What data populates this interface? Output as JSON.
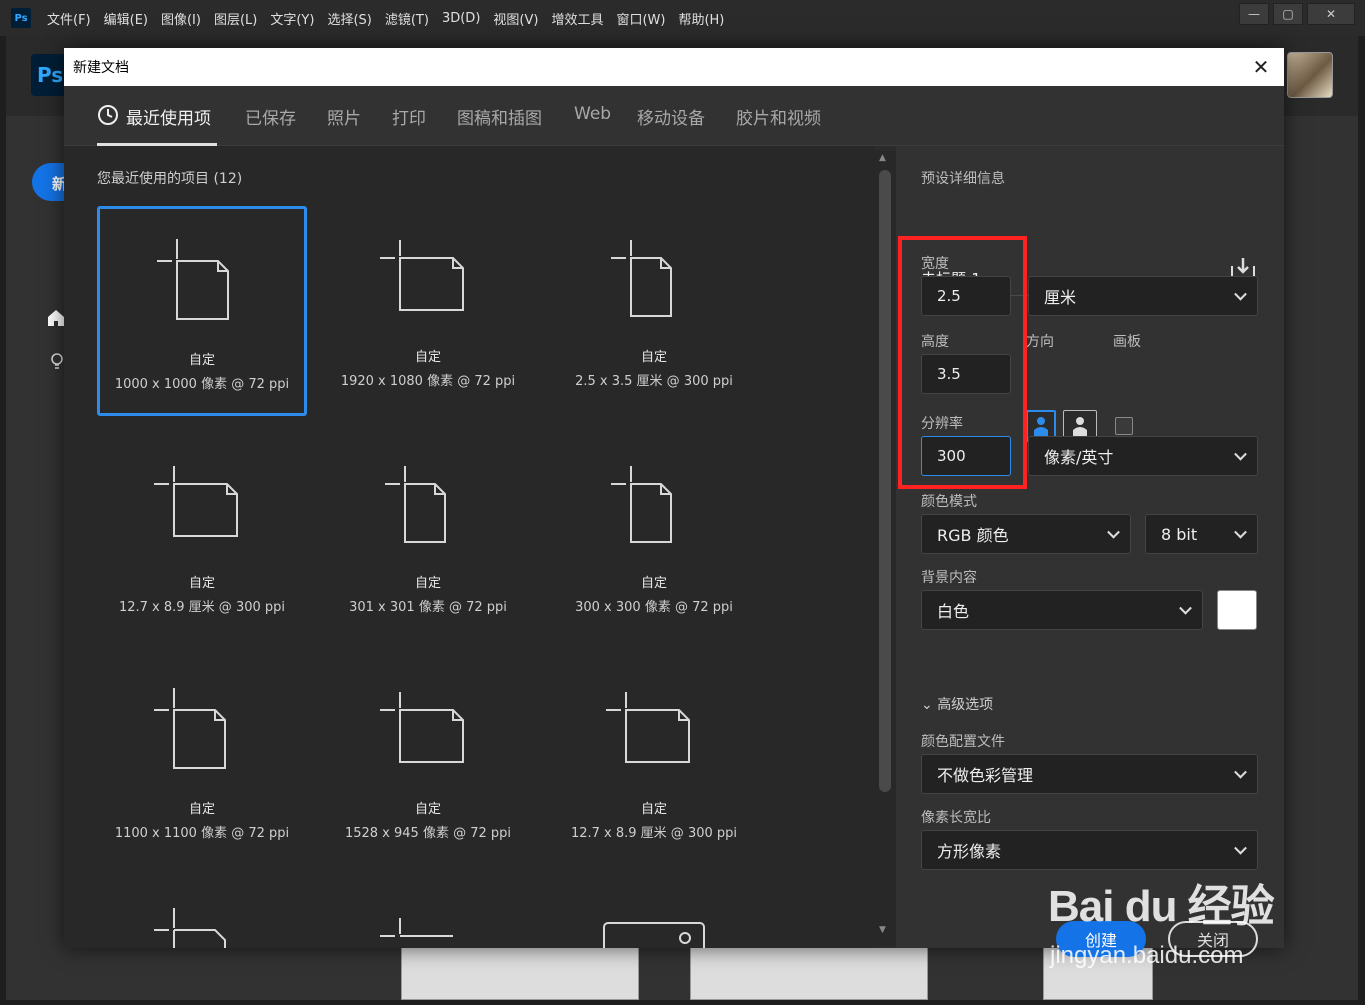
{
  "menubar": {
    "logo": "Ps",
    "items": [
      "文件(F)",
      "编辑(E)",
      "图像(I)",
      "图层(L)",
      "文字(Y)",
      "选择(S)",
      "滤镜(T)",
      "3D(D)",
      "视图(V)",
      "增效工具",
      "窗口(W)",
      "帮助(H)"
    ],
    "window_controls": [
      "—",
      "▢",
      "✕"
    ]
  },
  "home": {
    "logo": "Ps",
    "new_button": "新"
  },
  "dialog": {
    "title": "新建文档",
    "close": "✕",
    "tabs": [
      "最近使用项",
      "已保存",
      "照片",
      "打印",
      "图稿和插图",
      "Web",
      "移动设备",
      "胶片和视频"
    ],
    "recent_heading": "您最近使用的项目 (12)",
    "presets": [
      {
        "name": "自定",
        "size": "1000 x 1000 像素 @ 72 ppi",
        "selected": true
      },
      {
        "name": "自定",
        "size": "1920 x 1080 像素 @ 72 ppi"
      },
      {
        "name": "自定",
        "size": "2.5 x 3.5 厘米 @ 300 ppi"
      },
      {
        "name": "自定",
        "size": "12.7 x 8.9 厘米 @ 300 ppi"
      },
      {
        "name": "自定",
        "size": "301 x 301 像素 @ 72 ppi"
      },
      {
        "name": "自定",
        "size": "300 x 300 像素 @ 72 ppi"
      },
      {
        "name": "自定",
        "size": "1100 x 1100 像素 @ 72 ppi"
      },
      {
        "name": "自定",
        "size": "1528 x 945 像素 @ 72 ppi"
      },
      {
        "name": "自定",
        "size": "12.7 x 8.9 厘米 @ 300 ppi"
      }
    ],
    "details": {
      "section_title": "预设详细信息",
      "doc_name": "未标题-1",
      "width_label": "宽度",
      "width_value": "2.5",
      "unit": "厘米",
      "height_label": "高度",
      "height_value": "3.5",
      "orientation_label": "方向",
      "artboard_label": "画板",
      "resolution_label": "分辨率",
      "resolution_value": "300",
      "resolution_unit": "像素/英寸",
      "color_mode_label": "颜色模式",
      "color_mode": "RGB 颜色",
      "bit_depth": "8 bit",
      "bg_label": "背景内容",
      "bg_value": "白色",
      "advanced_label": "高级选项",
      "profile_label": "颜色配置文件",
      "profile_value": "不做色彩管理",
      "pixel_aspect_label": "像素长宽比",
      "pixel_aspect_value": "方形像素",
      "create": "创建",
      "close": "关闭"
    }
  },
  "watermark": {
    "logo": "Bai du 经验",
    "url": "jingyan.baidu.com"
  },
  "colors": {
    "accent": "#1473e6",
    "highlight": "#ff2222",
    "selection": "#2d8ceb"
  }
}
